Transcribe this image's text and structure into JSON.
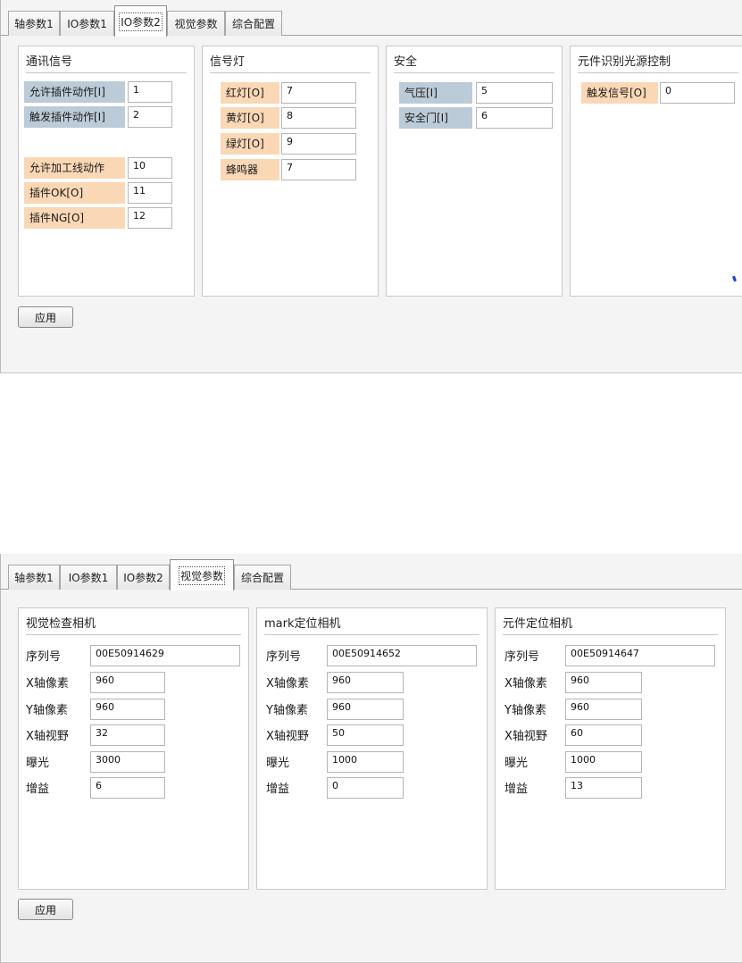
{
  "tabs": [
    "轴参数1",
    "IO参数1",
    "IO参数2",
    "视觉参数",
    "综合配置"
  ],
  "io_window": {
    "active_tab": "IO参数2",
    "panels": {
      "comm": {
        "title": "通讯信号",
        "rows": [
          {
            "label": "允许插件动作[I]",
            "value": "1"
          },
          {
            "label": "触发插件动作[I]",
            "value": "2"
          },
          {
            "label": "允许加工线动作",
            "value": "10"
          },
          {
            "label": "插件OK[O]",
            "value": "11"
          },
          {
            "label": "插件NG[O]",
            "value": "12"
          }
        ]
      },
      "light": {
        "title": "信号灯",
        "rows": [
          {
            "label": "红灯[O]",
            "value": "7"
          },
          {
            "label": "黄灯[O]",
            "value": "8"
          },
          {
            "label": "绿灯[O]",
            "value": "9"
          },
          {
            "label": "蜂鸣器",
            "value": "7"
          }
        ]
      },
      "safety": {
        "title": "安全",
        "rows": [
          {
            "label": "气压[I]",
            "value": "5"
          },
          {
            "label": "安全门[I]",
            "value": "6"
          }
        ]
      },
      "source": {
        "title": "元件识别光源控制",
        "rows": [
          {
            "label": "触发信号[O]",
            "value": "0"
          }
        ]
      }
    },
    "apply_label": "应用"
  },
  "vision_window": {
    "active_tab": "视觉参数",
    "field_labels": [
      "序列号",
      "X轴像素",
      "Y轴像素",
      "X轴视野",
      "曝光",
      "增益"
    ],
    "cameras": [
      {
        "title": "视觉检查相机",
        "values": [
          "00E50914629",
          "960",
          "960",
          "32",
          "3000",
          "6"
        ]
      },
      {
        "title": "mark定位相机",
        "values": [
          "00E50914652",
          "960",
          "960",
          "50",
          "1000",
          "0"
        ]
      },
      {
        "title": "元件定位相机",
        "values": [
          "00E50914647",
          "960",
          "960",
          "60",
          "1000",
          "13"
        ]
      }
    ],
    "apply_label": "应用"
  },
  "colors": {
    "label_blue": "#bccbd8",
    "label_peach": "#fad8b6"
  }
}
